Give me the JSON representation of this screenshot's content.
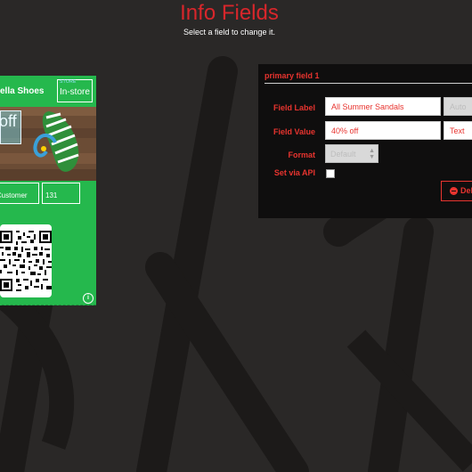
{
  "header": {
    "title": "Info Fields",
    "subtitle": "Select a field to change it."
  },
  "pass": {
    "organization": "ella Shoes",
    "header_field": {
      "label": "STORE",
      "value": "In-store"
    },
    "primary_field": {
      "value": "off"
    },
    "secondary_fields": [
      {
        "label": "",
        "value": "r Customer"
      },
      {
        "label": "",
        "value": "131"
      }
    ],
    "info_icon": "info-icon"
  },
  "panel": {
    "title": "primary field 1",
    "field_label_label": "Field Label",
    "field_label_value": "All Summer Sandals",
    "field_label_key": "Auto",
    "field_value_label": "Field Value",
    "field_value_value": "40% off",
    "field_value_type": "Text",
    "format_label": "Format",
    "format_value": "Default",
    "set_via_api_label": "Set via API",
    "delete_label": "Del"
  },
  "colors": {
    "accent": "#e8342f",
    "pass_bg": "#25b84d",
    "page_bg": "#2a2827",
    "panel_bg": "#0f0e0e"
  }
}
